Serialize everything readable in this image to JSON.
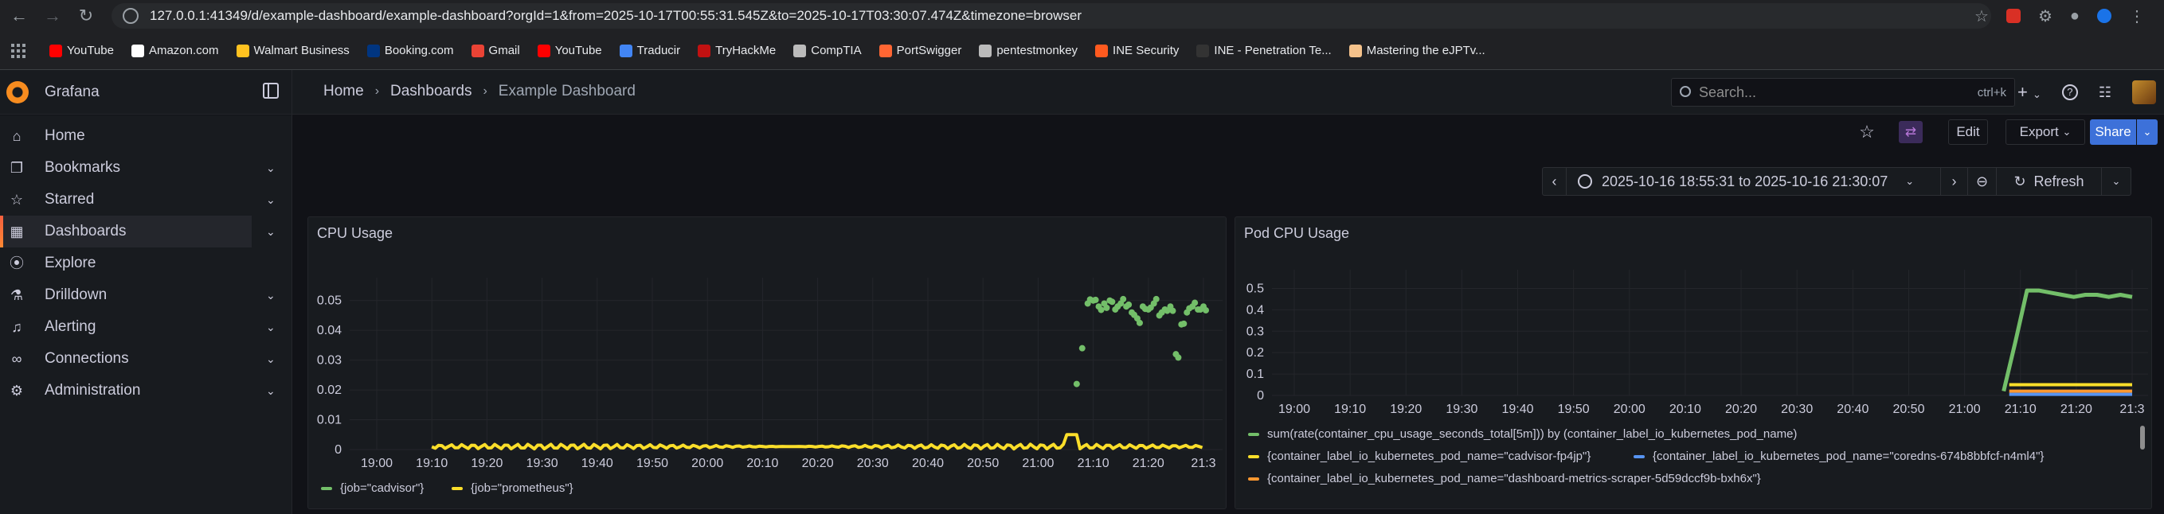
{
  "browser": {
    "url": "127.0.0.1:41349/d/example-dashboard/example-dashboard?orgId=1&from=2025-10-17T00:55:31.545Z&to=2025-10-17T03:30:07.474Z&timezone=browser",
    "bookmarks": [
      {
        "label": "YouTube",
        "color": "#ff0000"
      },
      {
        "label": "Amazon.com",
        "color": "#ffffff"
      },
      {
        "label": "Walmart Business",
        "color": "#ffc220"
      },
      {
        "label": "Booking.com",
        "color": "#003580"
      },
      {
        "label": "Gmail",
        "color": "#ea4335"
      },
      {
        "label": "YouTube",
        "color": "#ff0000"
      },
      {
        "label": "Traducir",
        "color": "#4285f4"
      },
      {
        "label": "TryHackMe",
        "color": "#c11111"
      },
      {
        "label": "CompTIA",
        "color": "#bbbbbb"
      },
      {
        "label": "PortSwigger",
        "color": "#ff6633"
      },
      {
        "label": "pentestmonkey",
        "color": "#bbbbbb"
      },
      {
        "label": "INE Security",
        "color": "#ff5a1f"
      },
      {
        "label": "INE - Penetration Te...",
        "color": "#333333"
      },
      {
        "label": "Mastering the eJPTv...",
        "color": "#f5c28b"
      }
    ]
  },
  "app": {
    "name": "Grafana",
    "breadcrumb": [
      "Home",
      "Dashboards",
      "Example Dashboard"
    ],
    "search_placeholder": "Search...",
    "search_shortcut": "ctrl+k"
  },
  "sidebar": {
    "items": [
      {
        "label": "Home",
        "icon": "home-icon",
        "chevron": false
      },
      {
        "label": "Bookmarks",
        "icon": "bookmark-icon",
        "chevron": true
      },
      {
        "label": "Starred",
        "icon": "star-icon",
        "chevron": true
      },
      {
        "label": "Dashboards",
        "icon": "grid-icon",
        "chevron": true,
        "active": true
      },
      {
        "label": "Explore",
        "icon": "compass-icon",
        "chevron": false
      },
      {
        "label": "Drilldown",
        "icon": "drilldown-icon",
        "chevron": true
      },
      {
        "label": "Alerting",
        "icon": "bell-icon",
        "chevron": true
      },
      {
        "label": "Connections",
        "icon": "link-icon",
        "chevron": true
      },
      {
        "label": "Administration",
        "icon": "gear-icon",
        "chevron": true
      }
    ]
  },
  "toolbar": {
    "edit_label": "Edit",
    "export_label": "Export",
    "share_label": "Share"
  },
  "time_range": {
    "label": "2025-10-16 18:55:31 to 2025-10-16 21:30:07",
    "refresh_label": "Refresh"
  },
  "colors": {
    "green": "#73bf69",
    "yellow": "#fade2a",
    "blue": "#5794f2",
    "orange": "#ff9830",
    "share_blue": "#3d71d9"
  },
  "panels": {
    "cpu": {
      "title": "CPU Usage",
      "legend": [
        "{job=\"cadvisor\"}",
        "{job=\"prometheus\"}"
      ]
    },
    "pod": {
      "title": "Pod CPU Usage",
      "legend": [
        "sum(rate(container_cpu_usage_seconds_total[5m])) by (container_label_io_kubernetes_pod_name)",
        "{container_label_io_kubernetes_pod_name=\"cadvisor-fp4jp\"}",
        "{container_label_io_kubernetes_pod_name=\"coredns-674b8bbfcf-n4ml4\"}",
        "{container_label_io_kubernetes_pod_name=\"dashboard-metrics-scraper-5d59dccf9b-bxh6x\"}"
      ]
    }
  },
  "chart_data": [
    {
      "type": "scatter",
      "title": "CPU Usage",
      "x_ticks": [
        "19:00",
        "19:10",
        "19:20",
        "19:30",
        "19:40",
        "19:50",
        "20:00",
        "20:10",
        "20:20",
        "20:30",
        "20:40",
        "20:50",
        "21:00",
        "21:10",
        "21:20",
        "21:3"
      ],
      "y_ticks": [
        "0",
        "0.01",
        "0.02",
        "0.03",
        "0.04",
        "0.05"
      ],
      "ylim": [
        0,
        0.055
      ],
      "grid": true,
      "legend_position": "bottom",
      "series": [
        {
          "name": "{job=\"cadvisor\"}",
          "x_range": [
            "21:07",
            "21:30"
          ],
          "values": [
            0.022,
            0.034,
            0.049,
            0.05,
            0.048,
            0.049,
            0.05,
            0.047,
            0.049,
            0.048,
            0.046,
            0.044,
            0.048,
            0.047,
            0.049,
            0.045,
            0.047,
            0.048,
            0.032,
            0.042,
            0.046,
            0.048,
            0.047,
            0.048
          ]
        },
        {
          "name": "{job=\"prometheus\"}",
          "x_range": [
            "19:10",
            "21:30"
          ],
          "approx_value": 0.001,
          "peak": 0.005
        }
      ]
    },
    {
      "type": "scatter",
      "title": "Pod CPU Usage",
      "x_ticks": [
        "19:00",
        "19:10",
        "19:20",
        "19:30",
        "19:40",
        "19:50",
        "20:00",
        "20:10",
        "20:20",
        "20:30",
        "20:40",
        "20:50",
        "21:00",
        "21:10",
        "21:20",
        "21:3"
      ],
      "y_ticks": [
        "0",
        "0.1",
        "0.2",
        "0.3",
        "0.4",
        "0.5"
      ],
      "ylim": [
        0,
        0.55
      ],
      "grid": true,
      "legend_position": "bottom",
      "series": [
        {
          "name": "sum(rate(container_cpu_usage_seconds_total[5m])) by (container_label_io_kubernetes_pod_name)",
          "x_range": [
            "21:07",
            "21:30"
          ],
          "values": [
            0.02,
            0.25,
            0.49,
            0.49,
            0.48,
            0.47,
            0.46,
            0.47,
            0.47,
            0.46,
            0.47,
            0.46
          ]
        },
        {
          "name": "{container_label_io_kubernetes_pod_name=\"cadvisor-fp4jp\"}",
          "approx_value": 0.05
        },
        {
          "name": "{container_label_io_kubernetes_pod_name=\"coredns-674b8bbfcf-n4ml4\"}",
          "approx_value": 0.005
        },
        {
          "name": "{container_label_io_kubernetes_pod_name=\"dashboard-metrics-scraper-5d59dccf9b-bxh6x\"}",
          "approx_value": 0.02
        }
      ]
    }
  ]
}
